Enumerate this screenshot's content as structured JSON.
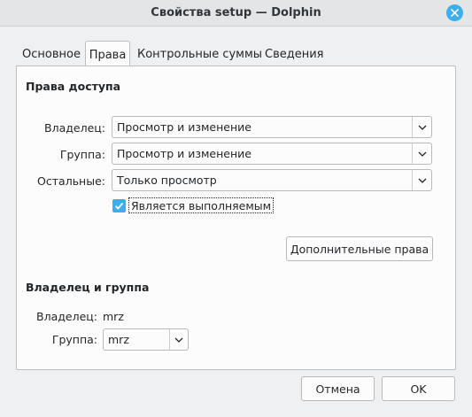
{
  "window": {
    "title": "Свойства setup — Dolphin"
  },
  "tabs": [
    {
      "label": "Основное",
      "active": false
    },
    {
      "label": "Права",
      "active": true
    },
    {
      "label": "Контрольные суммы",
      "active": false
    },
    {
      "label": "Сведения",
      "active": false
    }
  ],
  "access": {
    "title": "Права доступа",
    "owner_label": "Владелец:",
    "owner_value": "Просмотр и изменение",
    "group_label": "Группа:",
    "group_value": "Просмотр и изменение",
    "others_label": "Остальные:",
    "others_value": "Только просмотр",
    "executable_label": "Является выполняемым",
    "executable_checked": true,
    "advanced_button": "Дополнительные права"
  },
  "ownership": {
    "title": "Владелец и группа",
    "owner_label": "Владелец:",
    "owner_value": "mrz",
    "group_label": "Группа:",
    "group_value": "mrz"
  },
  "buttons": {
    "cancel": "Отмена",
    "ok": "OK"
  },
  "colors": {
    "accent": "#3daee9",
    "window_bg": "#eff0f1",
    "panel_bg": "#fcfcfc"
  },
  "icons": {
    "close": "close-icon",
    "dropdown": "chevron-down-icon",
    "check": "check-icon"
  }
}
